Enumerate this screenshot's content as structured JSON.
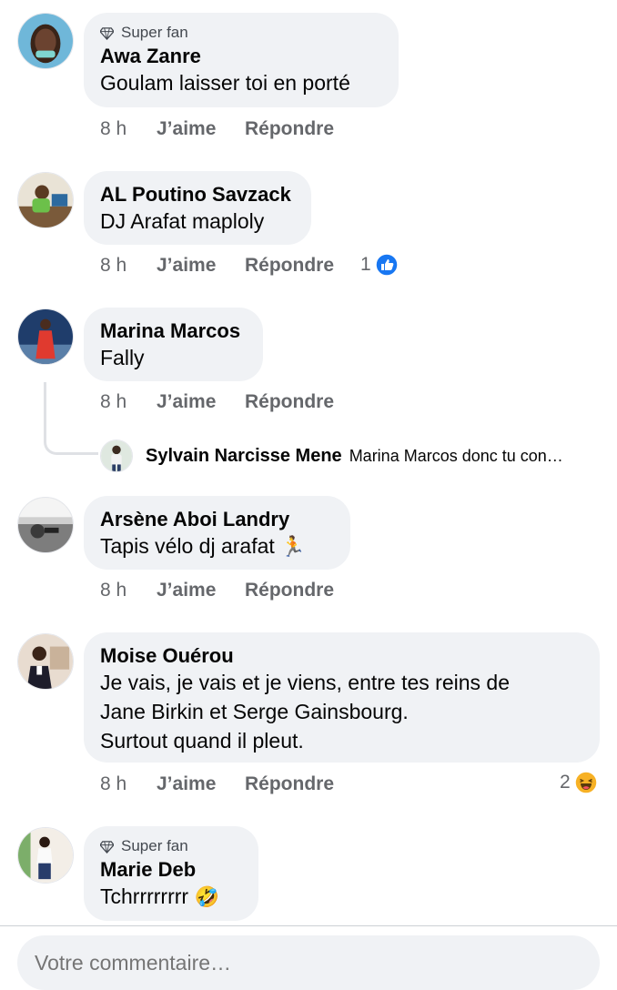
{
  "comments": [
    {
      "badge": "Super fan",
      "author": "Awa Zanre",
      "text": "Goulam laisser toi en porté",
      "time": "8 h",
      "like": "J’aime",
      "reply": "Répondre"
    },
    {
      "author": "AL Poutino Savzack",
      "text": "DJ Arafat maploly",
      "time": "8 h",
      "like": "J’aime",
      "reply": "Répondre",
      "reaction_count": "1",
      "reaction_icon": "like-reaction-icon"
    },
    {
      "author": "Marina Marcos",
      "text": "Fally",
      "time": "8 h",
      "like": "J’aime",
      "reply": "Répondre",
      "reply_preview": {
        "author": "Sylvain Narcisse Mene",
        "text": "Marina Marcos donc tu con…"
      }
    },
    {
      "author": "Arsène Aboi Landry",
      "text": "Tapis vélo dj arafat",
      "emoji": "🏃",
      "time": "8 h",
      "like": "J’aime",
      "reply": "Répondre"
    },
    {
      "author": "Moise Ouérou",
      "text_lines": [
        "Je vais, je vais et je viens, entre tes reins de",
        "Jane Birkin et Serge Gainsbourg.",
        "Surtout quand il pleut."
      ],
      "time": "8 h",
      "like": "J’aime",
      "reply": "Répondre",
      "reaction_count": "2",
      "reaction_icon": "haha-reaction-icon"
    },
    {
      "badge": "Super fan",
      "author": "Marie Deb",
      "text": "Tchrrrrrrrr",
      "emoji": "🤣"
    }
  ],
  "composer": {
    "placeholder": "Votre commentaire…"
  },
  "colors": {
    "bubble": "#f0f2f5",
    "meta": "#65676b",
    "like_blue": "#1877f2",
    "haha_yellow": "#f7b125"
  }
}
